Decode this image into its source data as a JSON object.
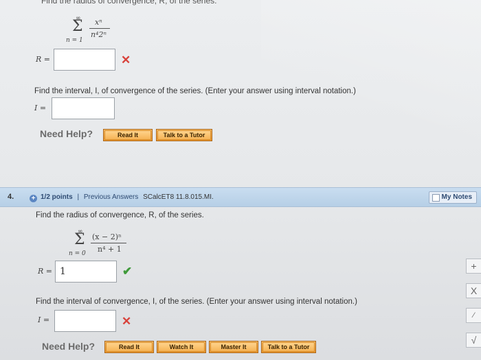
{
  "prev_question": {
    "cut_text": "Find the radius of convergence, R, of the series.",
    "series": {
      "sigma_top": "∞",
      "sigma_bottom": "n = 1",
      "numerator": "xⁿ",
      "denominator": "n⁴2ⁿ"
    },
    "r_label": "R =",
    "r_value": "",
    "interval_prompt": "Find the interval, I, of convergence of the series. (Enter your answer using interval notation.)",
    "i_label": "I =",
    "i_value": "",
    "need_help": "Need Help?",
    "buttons": [
      "Read It",
      "Talk to a Tutor"
    ]
  },
  "question_bar": {
    "number": "4.",
    "points": "1/2 points",
    "separator": "|",
    "previous_answers": "Previous Answers",
    "code": "SCalcET8 11.8.015.MI.",
    "my_notes": "My Notes"
  },
  "question4": {
    "prompt": "Find the radius of convergence, R, of the series.",
    "series": {
      "sigma_top": "∞",
      "sigma_bottom": "n = 0",
      "numerator": "(x − 2)ⁿ",
      "denominator": "n⁴ + 1"
    },
    "r_label": "R =",
    "r_value": "1",
    "interval_prompt": "Find the interval of convergence, I, of the series. (Enter your answer using interval notation.)",
    "i_label": "I =",
    "i_value": "",
    "need_help": "Need Help?",
    "buttons": [
      "Read It",
      "Watch It",
      "Master It",
      "Talk to a Tutor"
    ]
  },
  "side_tools": [
    "+",
    "X",
    "⁄",
    "√"
  ]
}
